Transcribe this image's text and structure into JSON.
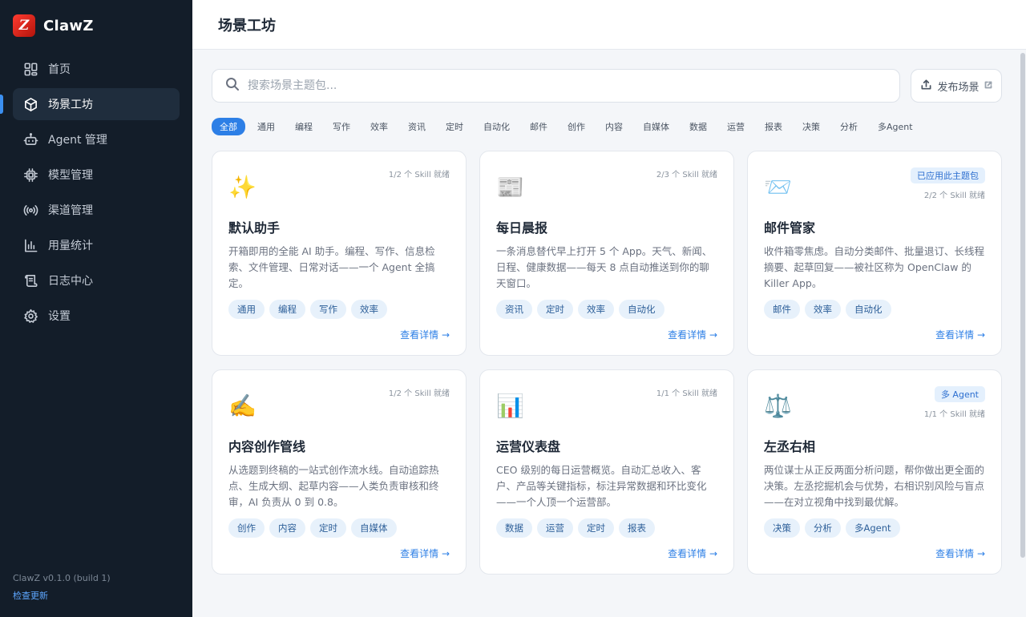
{
  "brand": {
    "name": "ClawZ",
    "logo_letter": "Z"
  },
  "sidebar": {
    "items": [
      {
        "label": "首页",
        "icon": "grid-icon"
      },
      {
        "label": "场景工坊",
        "icon": "cube-icon",
        "active": true
      },
      {
        "label": "Agent 管理",
        "icon": "robot-icon"
      },
      {
        "label": "模型管理",
        "icon": "chip-icon"
      },
      {
        "label": "渠道管理",
        "icon": "broadcast-icon"
      },
      {
        "label": "用量统计",
        "icon": "bar-chart-icon"
      },
      {
        "label": "日志中心",
        "icon": "scroll-icon"
      },
      {
        "label": "设置",
        "icon": "gear-icon"
      }
    ],
    "version": "ClawZ v0.1.0 (build 1)",
    "update_label": "检查更新"
  },
  "header": {
    "title": "场景工坊"
  },
  "search": {
    "placeholder": "搜索场景主题包..."
  },
  "publish": {
    "label": "发布场景"
  },
  "filters": [
    "全部",
    "通用",
    "编程",
    "写作",
    "效率",
    "资讯",
    "定时",
    "自动化",
    "邮件",
    "创作",
    "内容",
    "自媒体",
    "数据",
    "运营",
    "报表",
    "决策",
    "分析",
    "多Agent"
  ],
  "detail_label": "查看详情 →",
  "cards": [
    {
      "emoji": "✨",
      "title": "默认助手",
      "status": "1/2 个 Skill 就绪",
      "badge": "",
      "desc": "开箱即用的全能 AI 助手。编程、写作、信息检索、文件管理、日常对话——一个 Agent 全搞定。",
      "tags": [
        "通用",
        "编程",
        "写作",
        "效率"
      ]
    },
    {
      "emoji": "📰",
      "title": "每日晨报",
      "status": "2/3 个 Skill 就绪",
      "badge": "",
      "desc": "一条消息替代早上打开 5 个 App。天气、新闻、日程、健康数据——每天 8 点自动推送到你的聊天窗口。",
      "tags": [
        "资讯",
        "定时",
        "效率",
        "自动化"
      ]
    },
    {
      "emoji": "📨",
      "title": "邮件管家",
      "status": "2/2 个 Skill 就绪",
      "badge": "已应用此主题包",
      "desc": "收件箱零焦虑。自动分类邮件、批量退订、长线程摘要、起草回复——被社区称为 OpenClaw 的 Killer App。",
      "tags": [
        "邮件",
        "效率",
        "自动化"
      ]
    },
    {
      "emoji": "✍️",
      "title": "内容创作管线",
      "status": "1/2 个 Skill 就绪",
      "badge": "",
      "desc": "从选题到终稿的一站式创作流水线。自动追踪热点、生成大纲、起草内容——人类负责审核和终审，AI 负责从 0 到 0.8。",
      "tags": [
        "创作",
        "内容",
        "定时",
        "自媒体"
      ]
    },
    {
      "emoji": "📊",
      "title": "运营仪表盘",
      "status": "1/1 个 Skill 就绪",
      "badge": "",
      "desc": "CEO 级别的每日运营概览。自动汇总收入、客户、产品等关键指标，标注异常数据和环比变化——一个人顶一个运营部。",
      "tags": [
        "数据",
        "运营",
        "定时",
        "报表"
      ]
    },
    {
      "emoji": "⚖️",
      "title": "左丞右相",
      "status": "1/1 个 Skill 就绪",
      "badge": "多 Agent",
      "desc": "两位谋士从正反两面分析问题，帮你做出更全面的决策。左丞挖掘机会与优势，右相识别风险与盲点——在对立视角中找到最优解。",
      "tags": [
        "决策",
        "分析",
        "多Agent"
      ]
    }
  ]
}
